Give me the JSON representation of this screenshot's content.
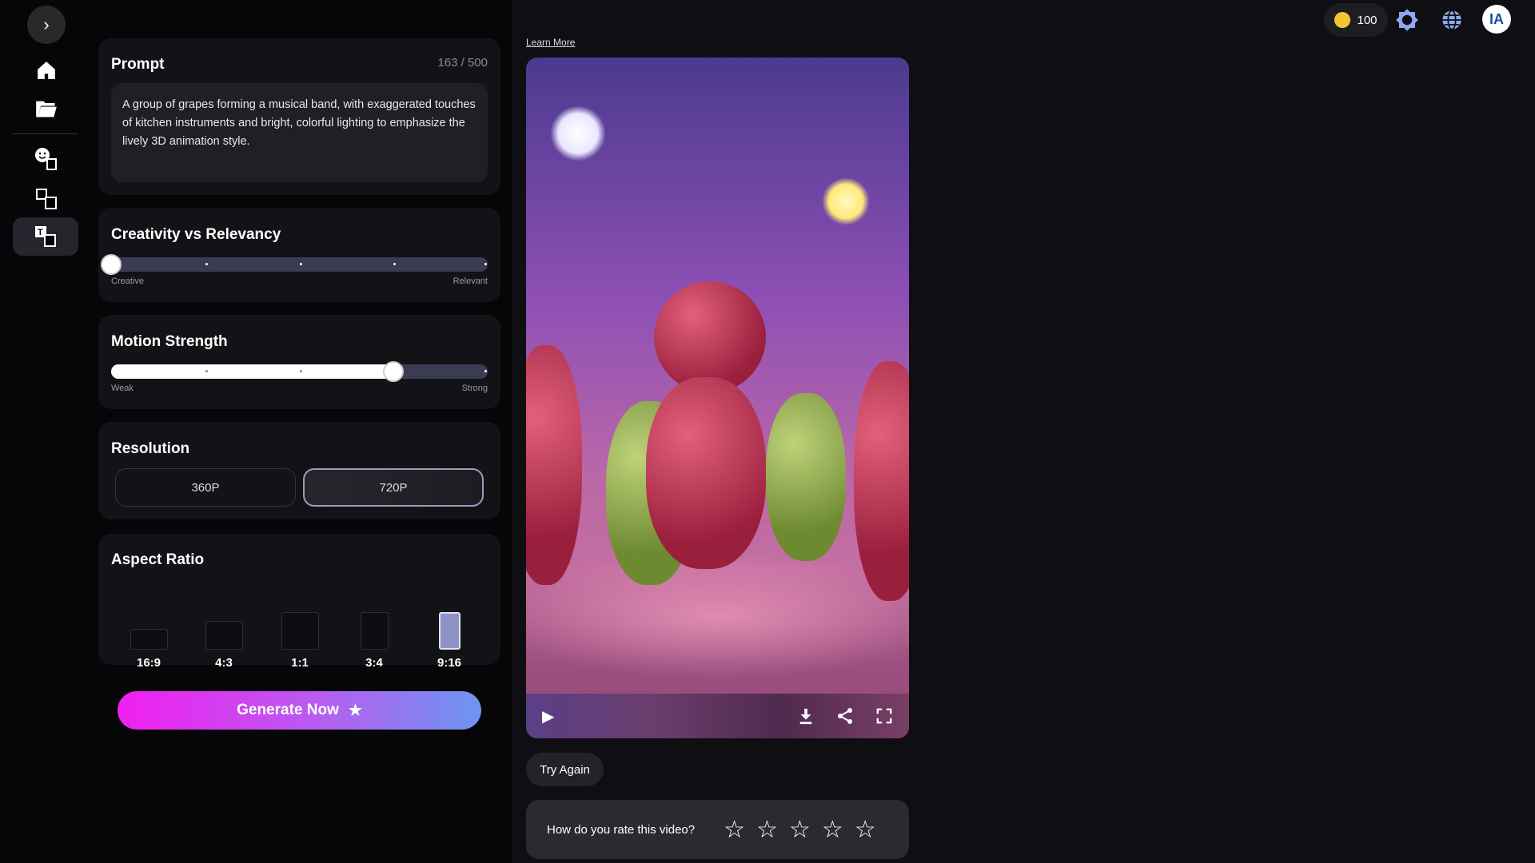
{
  "sidebar": {
    "items": [
      "home",
      "folder",
      "face-to-video",
      "image-to-video",
      "text-to-video"
    ],
    "active": "text-to-video"
  },
  "prompt": {
    "title": "Prompt",
    "counter": "163 / 500",
    "text": "A group of grapes forming a musical band, with exaggerated touches of kitchen instruments and bright, colorful lighting to emphasize the lively 3D animation style."
  },
  "creativity": {
    "title": "Creativity vs Relevancy",
    "min_label": "Creative",
    "max_label": "Relevant",
    "value_percent": 0
  },
  "motion": {
    "title": "Motion Strength",
    "min_label": "Weak",
    "max_label": "Strong",
    "value_percent": 75
  },
  "resolution": {
    "title": "Resolution",
    "options": [
      "360P",
      "720P"
    ],
    "selected": "720P"
  },
  "aspect": {
    "title": "Aspect Ratio",
    "options": [
      "16:9",
      "4:3",
      "1:1",
      "3:4",
      "9:16"
    ],
    "selected": "9:16"
  },
  "generate": {
    "label": "Generate Now"
  },
  "video": {
    "learn_more": "Learn More"
  },
  "try_again": "Try Again",
  "rating": {
    "question": "How do you rate this video?",
    "stars": 5,
    "value": 0
  },
  "topbar": {
    "credits": "100",
    "avatar_text": "IA"
  },
  "colors": {
    "accent_start": "#f11ff0",
    "accent_end": "#6d95f0",
    "icon_blue": "#8fa8f0"
  }
}
